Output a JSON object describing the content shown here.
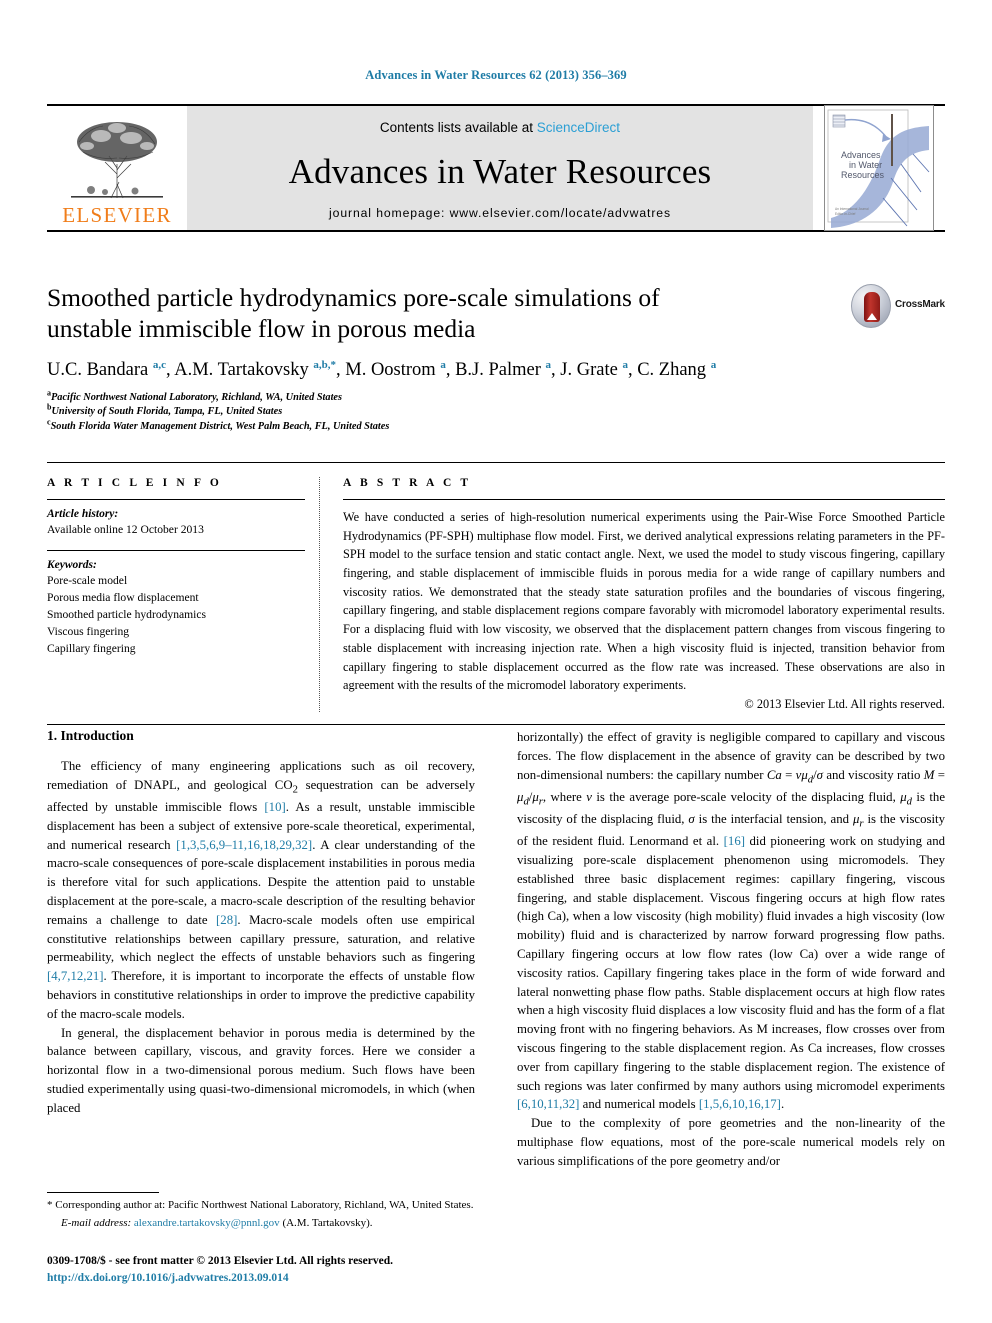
{
  "running_head": "Advances in Water Resources 62 (2013) 356–369",
  "masthead": {
    "contents_prefix": "Contents lists available at",
    "contents_link": "ScienceDirect",
    "journal_title": "Advances in Water Resources",
    "homepage": "journal homepage: www.elsevier.com/locate/advwatres",
    "publisher_wordmark": "ELSEVIER",
    "cover_title_lines": [
      "Advances",
      "in Water",
      "Resources"
    ]
  },
  "article": {
    "title": "Smoothed particle hydrodynamics pore-scale simulations of unstable immiscible flow in porous media",
    "crossmark_label": "CrossMark",
    "authors_html": "U.C. Bandara <sup>a,c</sup>, A.M. Tartakovsky <sup>a,b,</sup><sup>*</sup>, M. Oostrom <sup>a</sup>, B.J. Palmer <sup>a</sup>, J. Grate <sup>a</sup>, C. Zhang <sup>a</sup>",
    "affiliations": [
      {
        "marker": "a",
        "text": "Pacific Northwest National Laboratory, Richland, WA, United States"
      },
      {
        "marker": "b",
        "text": "University of South Florida, Tampa, FL, United States"
      },
      {
        "marker": "c",
        "text": "South Florida Water Management District, West Palm Beach, FL, United States"
      }
    ]
  },
  "article_info": {
    "heading": "A R T I C L E   I N F O",
    "history_label": "Article history:",
    "history_value": "Available online 12 October 2013",
    "keywords_label": "Keywords:",
    "keywords": [
      "Pore-scale model",
      "Porous media flow displacement",
      "Smoothed particle hydrodynamics",
      "Viscous fingering",
      "Capillary fingering"
    ]
  },
  "abstract": {
    "heading": "A B S T R A C T",
    "text": "We have conducted a series of high-resolution numerical experiments using the Pair-Wise Force Smoothed Particle Hydrodynamics (PF-SPH) multiphase flow model. First, we derived analytical expressions relating parameters in the PF-SPH model to the surface tension and static contact angle. Next, we used the model to study viscous fingering, capillary fingering, and stable displacement of immiscible fluids in porous media for a wide range of capillary numbers and viscosity ratios. We demonstrated that the steady state saturation profiles and the boundaries of viscous fingering, capillary fingering, and stable displacement regions compare favorably with micromodel laboratory experimental results. For a displacing fluid with low viscosity, we observed that the displacement pattern changes from viscous fingering to stable displacement with increasing injection rate. When a high viscosity fluid is injected, transition behavior from capillary fingering to stable displacement occurred as the flow rate was increased. These observations are also in agreement with the results of the micromodel laboratory experiments.",
    "copyright": "© 2013 Elsevier Ltd. All rights reserved."
  },
  "body": {
    "section_title": "1. Introduction",
    "left_paragraphs": [
      "The efficiency of many engineering applications such as oil recovery, remediation of DNAPL, and geological CO<sub>2</sub> sequestration can be adversely affected by unstable immiscible flows <span class=\"ref\">[10]</span>. As a result, unstable immiscible displacement has been a subject of extensive pore-scale theoretical, experimental, and numerical research <span class=\"ref\">[1,3,5,6,9–11,16,18,29,32]</span>. A clear understanding of the macro-scale consequences of pore-scale displacement instabilities in porous media is therefore vital for such applications. Despite the attention paid to unstable displacement at the pore-scale, a macro-scale description of the resulting behavior remains a challenge to date <span class=\"ref\">[28]</span>. Macro-scale models often use empirical constitutive relationships between capillary pressure, saturation, and relative permeability, which neglect the effects of unstable behaviors such as fingering <span class=\"ref\">[4,7,12,21]</span>. Therefore, it is important to incorporate the effects of unstable flow behaviors in constitutive relationships in order to improve the predictive capability of the macro-scale models.",
      "In general, the displacement behavior in porous media is determined by the balance between capillary, viscous, and gravity forces. Here we consider a horizontal flow in a two-dimensional porous medium. Such flows have been studied experimentally using quasi-two-dimensional micromodels, in which (when placed"
    ],
    "right_paragraphs": [
      "horizontally) the effect of gravity is negligible compared to capillary and viscous forces. The flow displacement in the absence of gravity can be described by two non-dimensional numbers: the capillary number <span class=\"mathit\">Ca</span> = <span class=\"mathit\">νμ<sub>d</sub></span>/<span class=\"mathit\">σ</span> and viscosity ratio <span class=\"mathit\">M</span> = <span class=\"mathit\">μ<sub>d</sub></span>/<span class=\"mathit\">μ<sub>r</sub></span>, where <span class=\"mathit\">ν</span> is the average pore-scale velocity of the displacing fluid, <span class=\"mathit\">μ<sub>d</sub></span> is the viscosity of the displacing fluid, <span class=\"mathit\">σ</span> is the interfacial tension, and <span class=\"mathit\">μ<sub>r</sub></span> is the viscosity of the resident fluid. Lenormand et al. <span class=\"ref\">[16]</span> did pioneering work on studying and visualizing pore-scale displacement phenomenon using micromodels. They established three basic displacement regimes: capillary fingering, viscous fingering, and stable displacement. Viscous fingering occurs at high flow rates (high Ca), when a low viscosity (high mobility) fluid invades a high viscosity (low mobility) fluid and is characterized by narrow forward progressing flow paths. Capillary fingering occurs at low flow rates (low Ca) over a wide range of viscosity ratios. Capillary fingering takes place in the form of wide forward and lateral nonwetting phase flow paths. Stable displacement occurs at high flow rates when a high viscosity fluid displaces a low viscosity fluid and has the form of a flat moving front with no fingering behaviors. As M increases, flow crosses over from viscous fingering to the stable displacement region. As Ca increases, flow crosses over from capillary fingering to the stable displacement region. The existence of such regions was later confirmed by many authors using micromodel experiments <span class=\"ref\">[6,10,11,32]</span> and numerical models <span class=\"ref\">[1,5,6,10,16,17]</span>.",
      "Due to the complexity of pore geometries and the non-linearity of the multiphase flow equations, most of the pore-scale numerical models rely on various simplifications of the pore geometry and/or"
    ]
  },
  "footnote": {
    "corresponding": "* Corresponding author at: Pacific Northwest National Laboratory, Richland, WA, United States.",
    "email_label": "E-mail address:",
    "email": "alexandre.tartakovsky@pnnl.gov",
    "email_suffix": "(A.M. Tartakovsky)."
  },
  "colophon": {
    "line1": "0309-1708/$ - see front matter © 2013 Elsevier Ltd. All rights reserved.",
    "line2": "http://dx.doi.org/10.1016/j.advwatres.2013.09.014"
  },
  "colors": {
    "link_blue": "#1f7ca6",
    "sciencedirect_blue": "#2b9fd4",
    "elsevier_orange": "#f07d1a",
    "masthead_gray": "#e3e3e3"
  }
}
